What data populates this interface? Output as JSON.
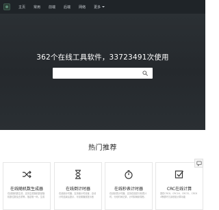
{
  "nav": {
    "items": [
      {
        "label": "主页"
      },
      {
        "label": "常用"
      },
      {
        "label": "前端"
      },
      {
        "label": "后端"
      },
      {
        "label": "网络"
      },
      {
        "label": "更多"
      }
    ]
  },
  "hero": {
    "title": "362个在线工具软件，33723491次使用",
    "search_value": ""
  },
  "section": {
    "title": "热门推荐"
  },
  "cards": [
    {
      "icon": "shuffle-icon",
      "title": "在线随机数生成器",
      "desc": "在线随机数生成，支持生成随机数量随机数位数及去重等，指定唯一码，生成符合随机要求的数"
    },
    {
      "icon": "hourglass-icon",
      "title": "在线倒计时器",
      "desc": "在线倒计时器，支持倒计时设置，自动计时结束后提示，可设置播放提示音"
    },
    {
      "icon": "stopwatch-icon",
      "title": "在线秒表计时器",
      "desc": "在线秒表计时器，支持在线进行秒表计时，分段时间记录，计时精确到毫秒，支持全屏"
    },
    {
      "icon": "checkbox-icon",
      "title": "CRC在线计算",
      "desc": "提供CRC8、CRC16、CRC32、CRC64等循环冗余校验计算功能"
    }
  ],
  "colors": {
    "navbar": "#1f2428",
    "hero": "#2a2f33",
    "text": "#222222"
  }
}
